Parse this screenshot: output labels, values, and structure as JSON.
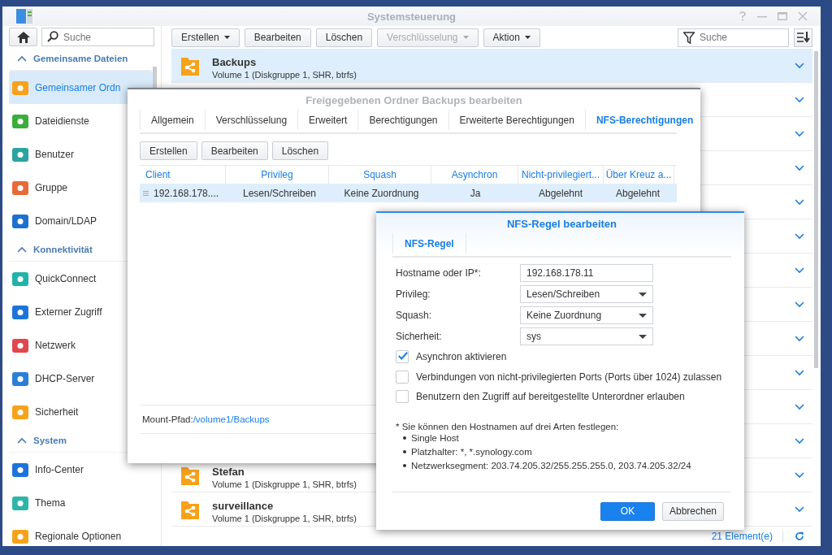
{
  "window": {
    "title": "Systemsteuerung"
  },
  "sidebar": {
    "search": {
      "placeholder": "Suche"
    },
    "sections": [
      {
        "title": "Gemeinsame Dateien",
        "expanded": true,
        "items": [
          {
            "label": "Gemeinsamer Ordn",
            "selected": true
          },
          {
            "label": "Dateidienste",
            "selected": false
          },
          {
            "label": "Benutzer",
            "selected": false
          },
          {
            "label": "Gruppe",
            "selected": false
          },
          {
            "label": "Domain/LDAP",
            "selected": false
          }
        ]
      },
      {
        "title": "Konnektivität",
        "expanded": true,
        "items": [
          {
            "label": "QuickConnect",
            "selected": false
          },
          {
            "label": "Externer Zugriff",
            "selected": false
          },
          {
            "label": "Netzwerk",
            "selected": false
          },
          {
            "label": "DHCP-Server",
            "selected": false
          },
          {
            "label": "Sicherheit",
            "selected": false
          }
        ]
      },
      {
        "title": "System",
        "expanded": true,
        "items": [
          {
            "label": "Info-Center",
            "selected": false
          },
          {
            "label": "Thema",
            "selected": false
          },
          {
            "label": "Regionale Optionen",
            "selected": false
          }
        ]
      }
    ]
  },
  "toolbar": {
    "buttons": [
      {
        "label": "Erstellen",
        "dropdown": true,
        "disabled": false
      },
      {
        "label": "Bearbeiten",
        "dropdown": false,
        "disabled": false
      },
      {
        "label": "Löschen",
        "dropdown": false,
        "disabled": false
      },
      {
        "label": "Verschlüsselung",
        "dropdown": true,
        "disabled": true
      },
      {
        "label": "Aktion",
        "dropdown": true,
        "disabled": false
      }
    ],
    "search": {
      "placeholder": "Suche"
    }
  },
  "folders": [
    {
      "kind": "folder",
      "name": "Backups",
      "volume": "Volume 1 (Diskgruppe 1, SHR, btrfs)",
      "selected": true
    },
    {
      "kind": "covered",
      "selected": false
    },
    {
      "kind": "covered",
      "selected": false
    },
    {
      "kind": "covered",
      "selected": false
    },
    {
      "kind": "covered",
      "selected": false
    },
    {
      "kind": "covered",
      "selected": false
    },
    {
      "kind": "covered",
      "selected": false
    },
    {
      "kind": "covered",
      "selected": false
    },
    {
      "kind": "covered",
      "selected": false
    },
    {
      "kind": "covered",
      "selected": false
    },
    {
      "kind": "covered",
      "selected": false
    },
    {
      "kind": "covered",
      "selected": false
    },
    {
      "kind": "folder",
      "name": "Stefan",
      "volume": "Volume 1 (Diskgruppe 1, SHR, btrfs)",
      "selected": false
    },
    {
      "kind": "folder",
      "name": "surveillance",
      "volume": "Volume 1 (Diskgruppe 1, SHR, btrfs)",
      "selected": false
    }
  ],
  "status_bar": {
    "count": "21 Element(e)"
  },
  "share_dialog": {
    "title": "Freigegebenen Ordner Backups bearbeiten",
    "tabs": [
      {
        "label": "Allgemein",
        "selected": false
      },
      {
        "label": "Verschlüsselung",
        "selected": false
      },
      {
        "label": "Erweitert",
        "selected": false
      },
      {
        "label": "Berechtigungen",
        "selected": false
      },
      {
        "label": "Erweiterte Berechtigungen",
        "selected": false
      },
      {
        "label": "NFS-Berechtigungen",
        "selected": true
      }
    ],
    "buttons": [
      "Erstellen",
      "Bearbeiten",
      "Löschen"
    ],
    "table": {
      "columns": [
        "Client",
        "Privileg",
        "Squash",
        "Asynchron",
        "Nicht-privilegiert...",
        "Über Kreuz a..."
      ],
      "rows": [
        {
          "cells": [
            "192.168.178....",
            "Lesen/Schreiben",
            "Keine Zuordnung",
            "Ja",
            "Abgelehnt",
            "Abgelehnt"
          ],
          "selected": true
        }
      ]
    },
    "mount_path": {
      "label": "Mount-Pfad:",
      "link": "/volume1/Backups"
    }
  },
  "rule_dialog": {
    "title": "NFS-Regel bearbeiten",
    "tabs": [
      {
        "label": "NFS-Regel",
        "selected": true
      }
    ],
    "fields": [
      {
        "label": "Hostname oder IP*:",
        "kind": "text",
        "value": "192.168.178.11"
      },
      {
        "label": "Privileg:",
        "kind": "select",
        "value": "Lesen/Schreiben"
      },
      {
        "label": "Squash:",
        "kind": "select",
        "value": "Keine Zuordnung"
      },
      {
        "label": "Sicherheit:",
        "kind": "select",
        "value": "sys"
      }
    ],
    "checkboxes": [
      {
        "label": "Asynchron aktivieren",
        "checked": true
      },
      {
        "label": "Verbindungen von nicht-privilegierten Ports (Ports über 1024) zulassen",
        "checked": false
      },
      {
        "label": "Benutzern den Zugriff auf bereitgestellte Unterordner erlauben",
        "checked": false
      }
    ],
    "note": "* Sie können den Hostnamen auf drei Arten festlegen:",
    "bullets": [
      "Single Host",
      "Platzhalter: *, *.synology.com",
      "Netzwerksegment: 203.74.205.32/255.255.255.0, 203.74.205.32/24"
    ],
    "buttons": [
      {
        "label": "OK",
        "kind": "primary"
      },
      {
        "label": "Abbrechen",
        "kind": "secondary"
      }
    ]
  }
}
